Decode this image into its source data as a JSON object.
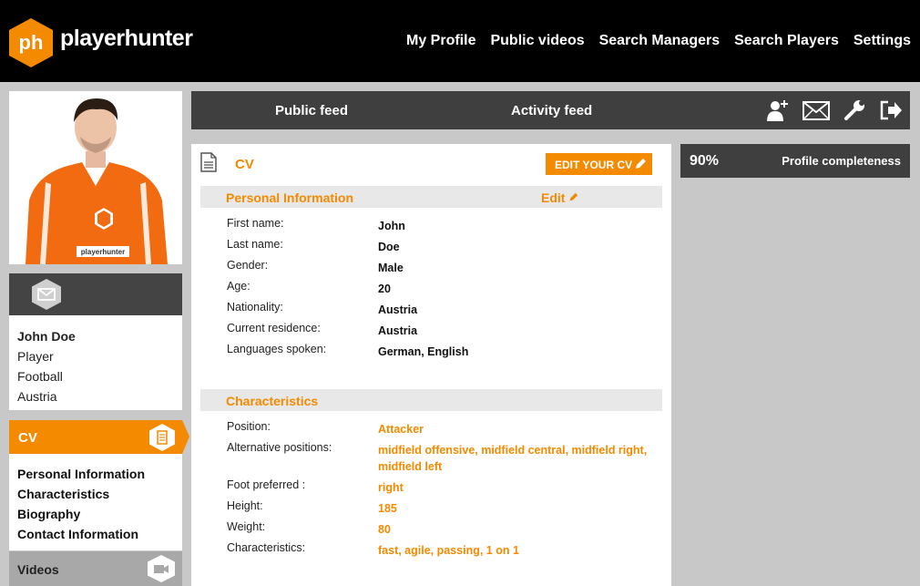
{
  "brand": {
    "name": "playerhunter",
    "mark": "ph",
    "color": "#f38a00"
  },
  "nav": [
    "My Profile",
    "Public videos",
    "Search Managers",
    "Search Players",
    "Settings"
  ],
  "profile": {
    "shirt_text": "playerhunter",
    "name": "John Doe",
    "role": "Player",
    "sport": "Football",
    "country": "Austria"
  },
  "cv_nav": {
    "title": "CV",
    "items": [
      "Personal Information",
      "Characteristics",
      "Biography",
      "Contact Information"
    ],
    "videos": "Videos"
  },
  "feed": {
    "public": "Public feed",
    "activity": "Activity feed",
    "icons": [
      "add-user-icon",
      "mail-icon",
      "wrench-icon",
      "logout-icon"
    ]
  },
  "cv": {
    "title": "CV",
    "edit_button": "EDIT YOUR CV",
    "personal": {
      "title": "Personal Information",
      "edit": "Edit",
      "rows": [
        {
          "label": "First name:",
          "value": "John"
        },
        {
          "label": "Last name:",
          "value": "Doe"
        },
        {
          "label": "Gender:",
          "value": "Male"
        },
        {
          "label": "Age:",
          "value": "20"
        },
        {
          "label": "Nationality:",
          "value": "Austria"
        },
        {
          "label": "Current residence:",
          "value": "Austria"
        },
        {
          "label": "Languages spoken:",
          "value": "German, English"
        }
      ]
    },
    "characteristics": {
      "title": "Characteristics",
      "rows": [
        {
          "label": "Position:",
          "value": "Attacker"
        },
        {
          "label": "Alternative positions:",
          "value": "midfield offensive, midfield central, midfield right, midfield left"
        },
        {
          "label": "Foot preferred :",
          "value": "right"
        },
        {
          "label": "Height:",
          "value": "185"
        },
        {
          "label": "Weight:",
          "value": "80"
        },
        {
          "label": "Characteristics:",
          "value": "fast, agile, passing, 1 on 1"
        }
      ]
    }
  },
  "completeness": {
    "percent": "90%",
    "label": "Profile completeness"
  }
}
